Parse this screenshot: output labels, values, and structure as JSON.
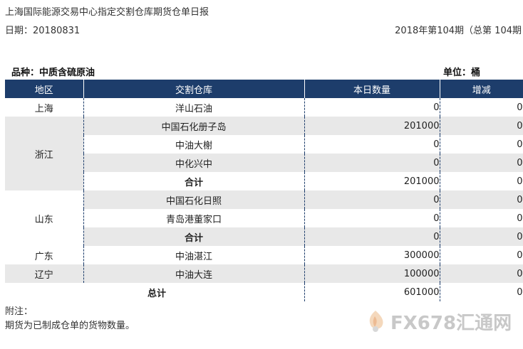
{
  "header": {
    "title": "上海国际能源交易中心指定交割仓库期货仓单日报",
    "date_text": "日期：20180831",
    "period_text": "2018年第104期（总第 104期"
  },
  "meta": {
    "variety": "品种：中质含硫原油",
    "unit": "单位：桶"
  },
  "table": {
    "columns": [
      "地区",
      "交割仓库",
      "本日数量",
      "增减"
    ],
    "rows": [
      {
        "region": "上海",
        "warehouse": "洋山石油",
        "quantity": "0",
        "change": "0"
      },
      {
        "region": "浙江",
        "warehouse": "中国石化册子岛",
        "quantity": "201000",
        "change": "0"
      },
      {
        "region": "",
        "warehouse": "中油大榭",
        "quantity": "0",
        "change": "0"
      },
      {
        "region": "",
        "warehouse": "中化兴中",
        "quantity": "0",
        "change": "0"
      },
      {
        "region": "",
        "warehouse": "合计",
        "quantity": "201000",
        "change": "0"
      },
      {
        "region": "山东",
        "warehouse": "中国石化日照",
        "quantity": "0",
        "change": "0"
      },
      {
        "region": "",
        "warehouse": "青岛港董家口",
        "quantity": "0",
        "change": "0"
      },
      {
        "region": "",
        "warehouse": "合计",
        "quantity": "0",
        "change": "0"
      },
      {
        "region": "广东",
        "warehouse": "中油湛江",
        "quantity": "300000",
        "change": "0"
      },
      {
        "region": "辽宁",
        "warehouse": "中油大连",
        "quantity": "100000",
        "change": "0"
      }
    ],
    "total": {
      "label": "总计",
      "quantity": "601000",
      "change": "0"
    }
  },
  "notes": {
    "label": "附注：",
    "text": "期货为已制成仓单的货物数量。"
  },
  "watermark": {
    "text": "FX678汇通网",
    "icon": "fx678-logo-icon"
  }
}
